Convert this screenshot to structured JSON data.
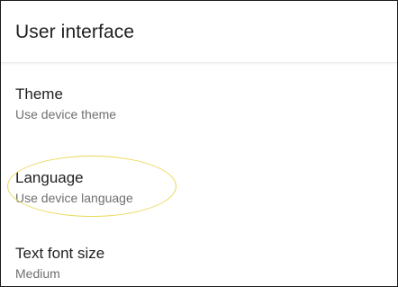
{
  "header": {
    "title": "User interface"
  },
  "settings": [
    {
      "title": "Theme",
      "value": "Use device theme"
    },
    {
      "title": "Language",
      "value": "Use device language"
    },
    {
      "title": "Text font size",
      "value": "Medium"
    }
  ],
  "colors": {
    "highlight": "#ead85a",
    "primary_text": "#1f1f1f",
    "secondary_text": "#6f6f6f"
  }
}
